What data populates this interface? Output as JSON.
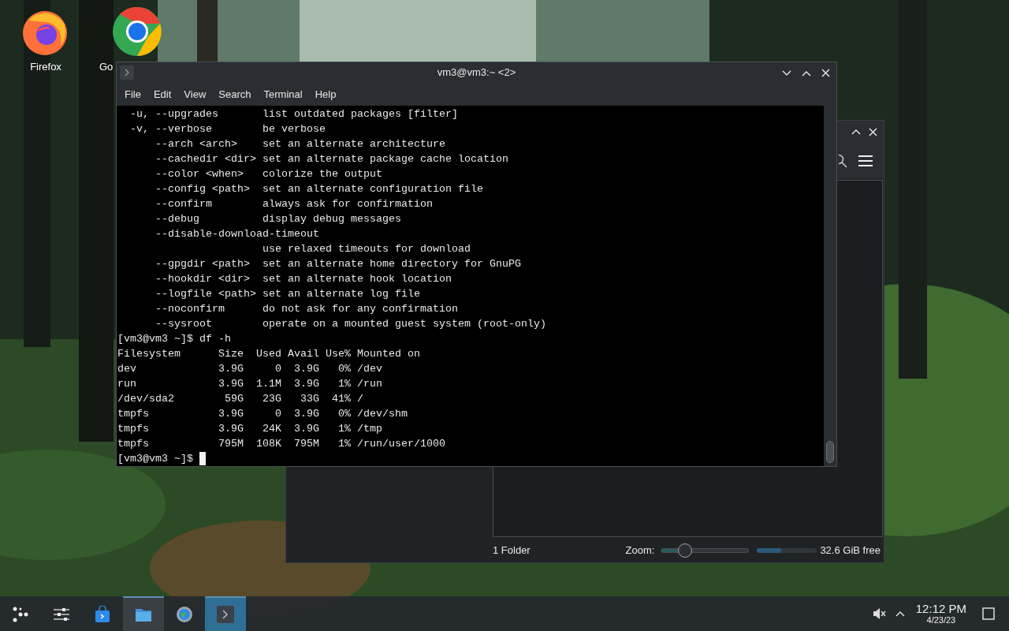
{
  "desktop_icons": [
    {
      "label": "Firefox",
      "kind": "firefox"
    },
    {
      "label": "Go",
      "kind": "chrome"
    }
  ],
  "file_manager": {
    "status": "1 Folder",
    "zoom_label": "Zoom:",
    "zoom": {
      "level": 0.27
    },
    "free_space": {
      "level": 0.4
    },
    "free_text": "32.6 GiB free"
  },
  "terminal": {
    "title": "vm3@vm3:~ <2>",
    "menu": [
      "File",
      "Edit",
      "View",
      "Search",
      "Terminal",
      "Help"
    ],
    "lines": [
      "  -u, --upgrades       list outdated packages [filter]",
      "  -v, --verbose        be verbose",
      "      --arch <arch>    set an alternate architecture",
      "      --cachedir <dir> set an alternate package cache location",
      "      --color <when>   colorize the output",
      "      --config <path>  set an alternate configuration file",
      "      --confirm        always ask for confirmation",
      "      --debug          display debug messages",
      "      --disable-download-timeout",
      "                       use relaxed timeouts for download",
      "      --gpgdir <path>  set an alternate home directory for GnuPG",
      "      --hookdir <dir>  set an alternate hook location",
      "      --logfile <path> set an alternate log file",
      "      --noconfirm      do not ask for any confirmation",
      "      --sysroot        operate on a mounted guest system (root-only)",
      "[vm3@vm3 ~]$ df -h",
      "Filesystem      Size  Used Avail Use% Mounted on",
      "dev             3.9G     0  3.9G   0% /dev",
      "run             3.9G  1.1M  3.9G   1% /run",
      "/dev/sda2        59G   23G   33G  41% /",
      "tmpfs           3.9G     0  3.9G   0% /dev/shm",
      "tmpfs           3.9G   24K  3.9G   1% /tmp",
      "tmpfs           795M  108K  795M   1% /run/user/1000",
      "[vm3@vm3 ~]$ "
    ],
    "cursor": true
  },
  "taskbar": {
    "items": [
      {
        "kind": "launcher",
        "selected": false,
        "open": false
      },
      {
        "kind": "sliders",
        "selected": false,
        "open": false
      },
      {
        "kind": "store",
        "selected": false,
        "open": false
      },
      {
        "kind": "folder",
        "selected": false,
        "open": true
      },
      {
        "kind": "globe",
        "selected": false,
        "open": false
      },
      {
        "kind": "terminal",
        "selected": true,
        "open": true
      }
    ],
    "clock": {
      "time": "12:12 PM",
      "date": "4/23/23"
    }
  }
}
